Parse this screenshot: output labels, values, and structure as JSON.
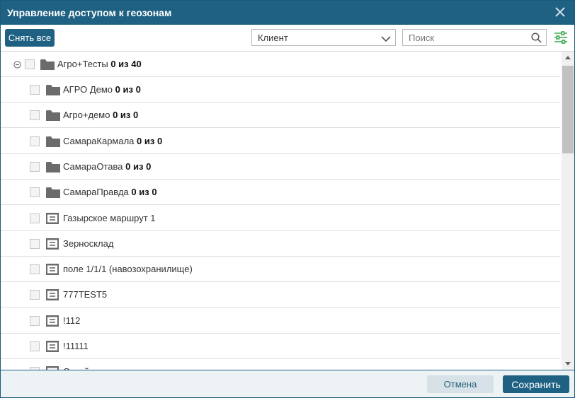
{
  "window": {
    "title": "Управление доступом к геозонам"
  },
  "toolbar": {
    "deselect_label": "Снять все",
    "client_select_value": "Клиент",
    "search_placeholder": "Поиск"
  },
  "tree": {
    "root": {
      "name": "Агро+Тесты",
      "count": "0 из 40"
    },
    "items": [
      {
        "type": "folder",
        "name": "АГРО Демо",
        "count": "0 из 0"
      },
      {
        "type": "folder",
        "name": "Агро+демо",
        "count": "0 из 0"
      },
      {
        "type": "folder",
        "name": "СамараКармала",
        "count": "0 из 0"
      },
      {
        "type": "folder",
        "name": "СамараОтава",
        "count": "0 из 0"
      },
      {
        "type": "folder",
        "name": "СамараПравда",
        "count": "0 из 0"
      },
      {
        "type": "geozone",
        "name": "Газырское маршрут 1"
      },
      {
        "type": "geozone",
        "name": "Зерносклад"
      },
      {
        "type": "geozone",
        "name": "поле 1/1/1 (навозохранилище)"
      },
      {
        "type": "geozone",
        "name": "777TEST5"
      },
      {
        "type": "geozone",
        "name": "!112"
      },
      {
        "type": "geozone",
        "name": "!11111"
      },
      {
        "type": "geozone",
        "name": "Стройцех"
      }
    ]
  },
  "footer": {
    "cancel_label": "Отмена",
    "save_label": "Сохранить"
  },
  "colors": {
    "header_bg": "#1e6182",
    "accent_green": "#3aa84b",
    "cancel_bg": "#d6e2e8"
  }
}
